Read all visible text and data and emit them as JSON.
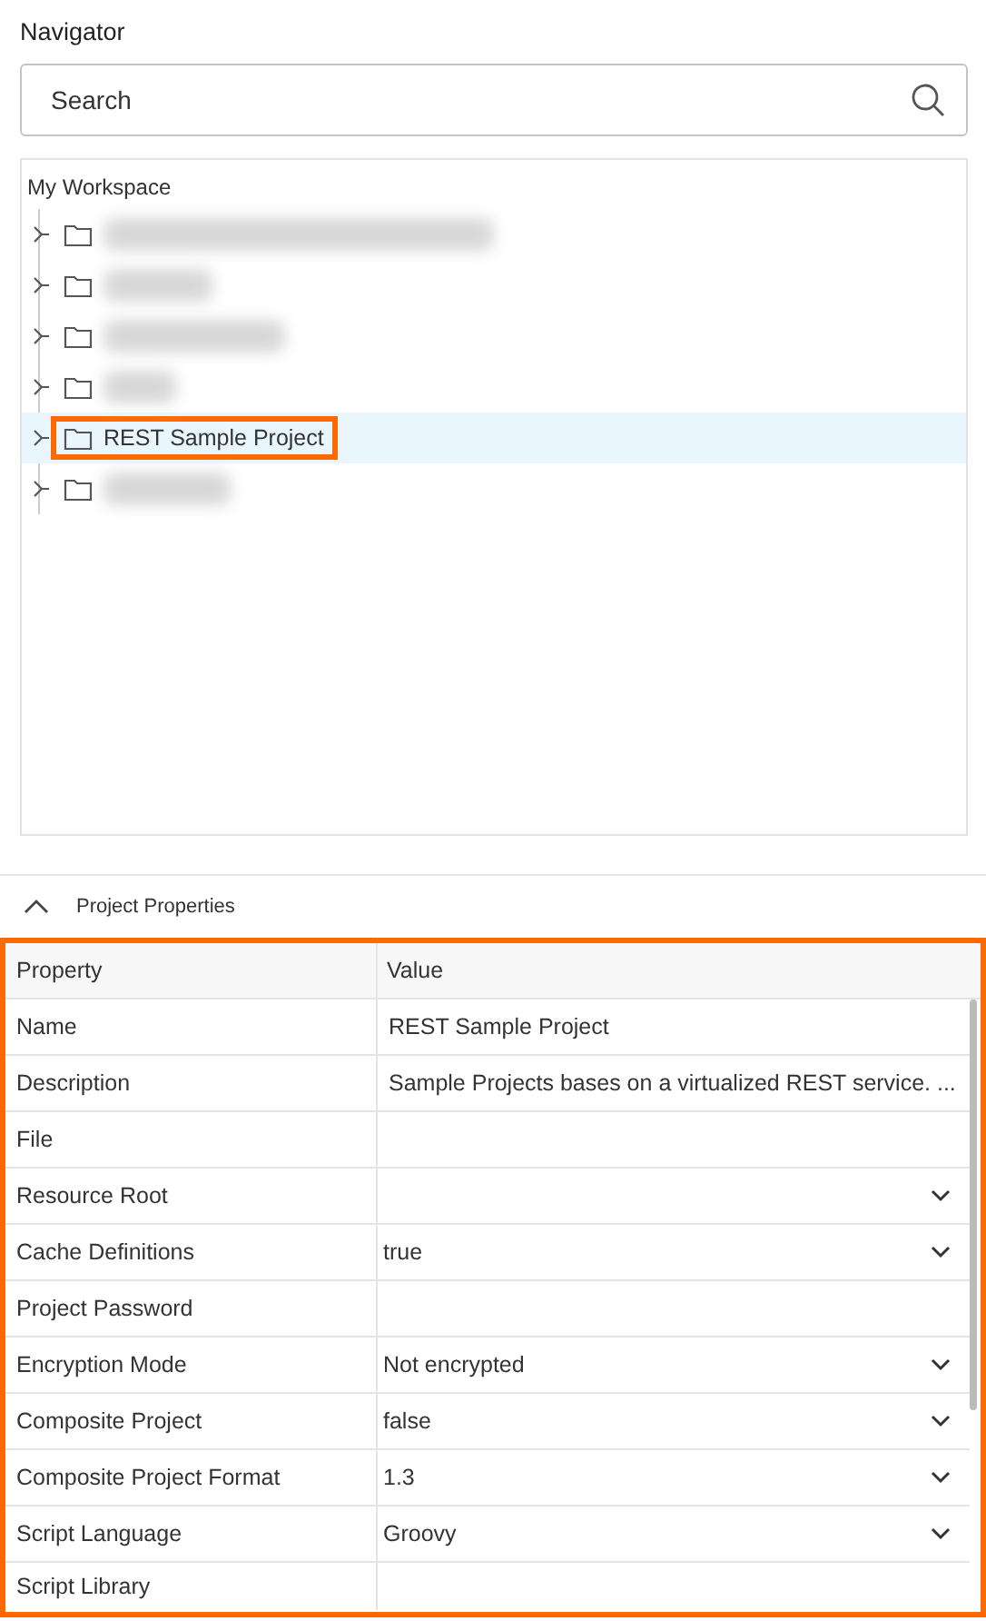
{
  "navigator": {
    "title": "Navigator",
    "search": {
      "placeholder": "Search"
    },
    "tree": {
      "root": "My Workspace",
      "items": [
        {
          "kind": "redacted",
          "selected": false,
          "highlighted": false
        },
        {
          "kind": "redacted",
          "selected": false,
          "highlighted": false
        },
        {
          "kind": "redacted",
          "selected": false,
          "highlighted": false
        },
        {
          "kind": "redacted",
          "selected": false,
          "highlighted": false
        },
        {
          "kind": "project",
          "label": "REST Sample Project",
          "selected": true,
          "highlighted": true
        },
        {
          "kind": "redacted",
          "selected": false,
          "highlighted": false
        }
      ]
    }
  },
  "properties": {
    "title": "Project Properties",
    "expanded": true,
    "highlighted": true,
    "columns": [
      "Property",
      "Value"
    ],
    "rows": [
      {
        "kind": "text",
        "property": "Name",
        "value": "REST Sample Project"
      },
      {
        "kind": "text",
        "property": "Description",
        "value": "Sample Projects bases on a virtualized REST service. ..."
      },
      {
        "kind": "text",
        "property": "File"
      },
      {
        "kind": "dropdown",
        "property": "Resource Root"
      },
      {
        "kind": "dropdown",
        "property": "Cache Definitions",
        "value": "true"
      },
      {
        "kind": "text",
        "property": "Project Password"
      },
      {
        "kind": "dropdown",
        "property": "Encryption Mode",
        "value": "Not encrypted"
      },
      {
        "kind": "dropdown",
        "property": "Composite Project",
        "value": "false"
      },
      {
        "kind": "dropdown",
        "property": "Composite Project Format",
        "value": "1.3"
      },
      {
        "kind": "dropdown",
        "property": "Script Language",
        "value": "Groovy"
      },
      {
        "kind": "text",
        "property": "Script Library"
      }
    ]
  }
}
